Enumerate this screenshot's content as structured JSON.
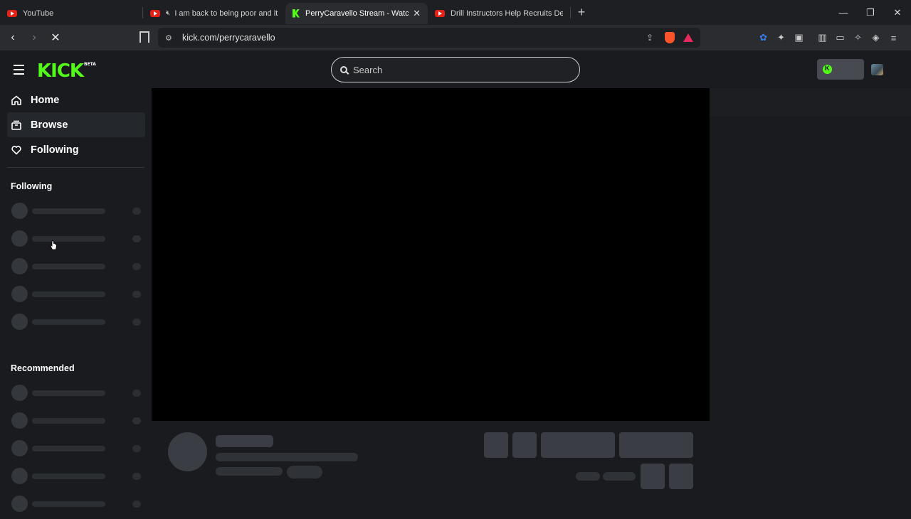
{
  "browser": {
    "tabs": [
      {
        "title": "YouTube",
        "icon": "youtube-icon",
        "active": false
      },
      {
        "title": "I am back to being poor and its a",
        "icon": "youtube-icon",
        "muted": true,
        "active": false
      },
      {
        "title": "PerryCaravello Stream - Watch Li",
        "icon": "kick-icon",
        "active": true
      },
      {
        "title": "Drill Instructors Help Recruits Develo",
        "icon": "youtube-icon",
        "active": false
      }
    ],
    "new_tab": "+",
    "window_controls": {
      "minimize": "—",
      "restore": "❐",
      "close": "✕"
    },
    "url": "kick.com/perrycaravello",
    "back": "‹",
    "forward": "›",
    "stop": "✕"
  },
  "header": {
    "logo": "KICK",
    "logo_badge": "BETA",
    "search": {
      "placeholder": "Search",
      "value": ""
    }
  },
  "sidebar": {
    "nav": [
      {
        "label": "Home",
        "icon": "home-icon",
        "selected": false
      },
      {
        "label": "Browse",
        "icon": "browse-icon",
        "selected": true
      },
      {
        "label": "Following",
        "icon": "heart-icon",
        "selected": false
      }
    ],
    "sections": {
      "following_title": "Following",
      "recommended_title": "Recommended"
    }
  },
  "colors": {
    "brand": "#53fc18",
    "background": "#191b1f",
    "video": "#000000",
    "skeleton": "#2f3237"
  }
}
